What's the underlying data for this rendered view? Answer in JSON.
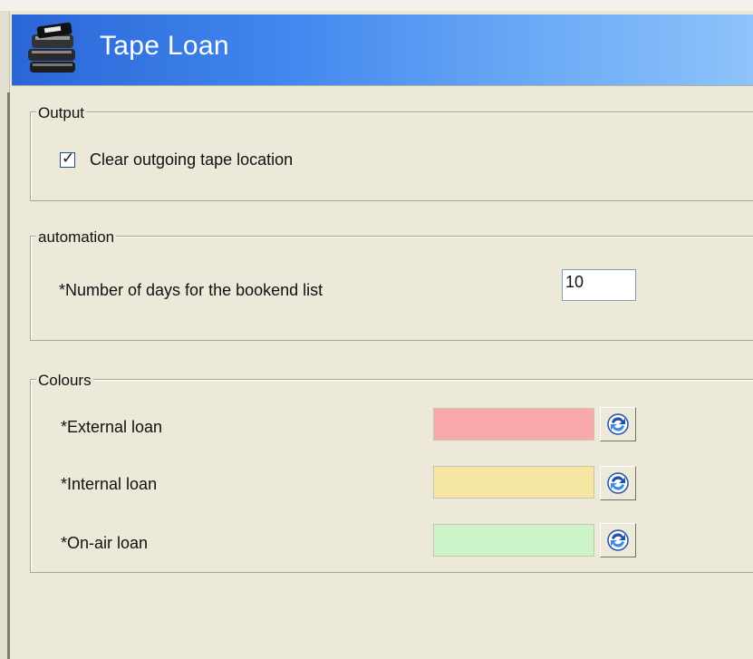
{
  "header": {
    "title": "Tape Loan",
    "icon": "tape-stack-icon"
  },
  "output": {
    "legend": "Output",
    "clear_location": {
      "label": "Clear outgoing tape location",
      "checked": true,
      "check_glyph": "✓"
    }
  },
  "automation": {
    "legend": "automation",
    "bookend_days": {
      "label": "*Number of days for the bookend list",
      "value": "10"
    }
  },
  "colours": {
    "legend": "Colours",
    "items": [
      {
        "label": "*External loan",
        "color": "#f9a9aa"
      },
      {
        "label": "*Internal loan",
        "color": "#f5e7a3"
      },
      {
        "label": "*On-air loan",
        "color": "#cdf3c9"
      }
    ],
    "reset_icon": "refresh-icon"
  },
  "colors": {
    "header_start": "#2a66d6",
    "header_end": "#8ec3fb",
    "panel_bg": "#ece9d8"
  }
}
